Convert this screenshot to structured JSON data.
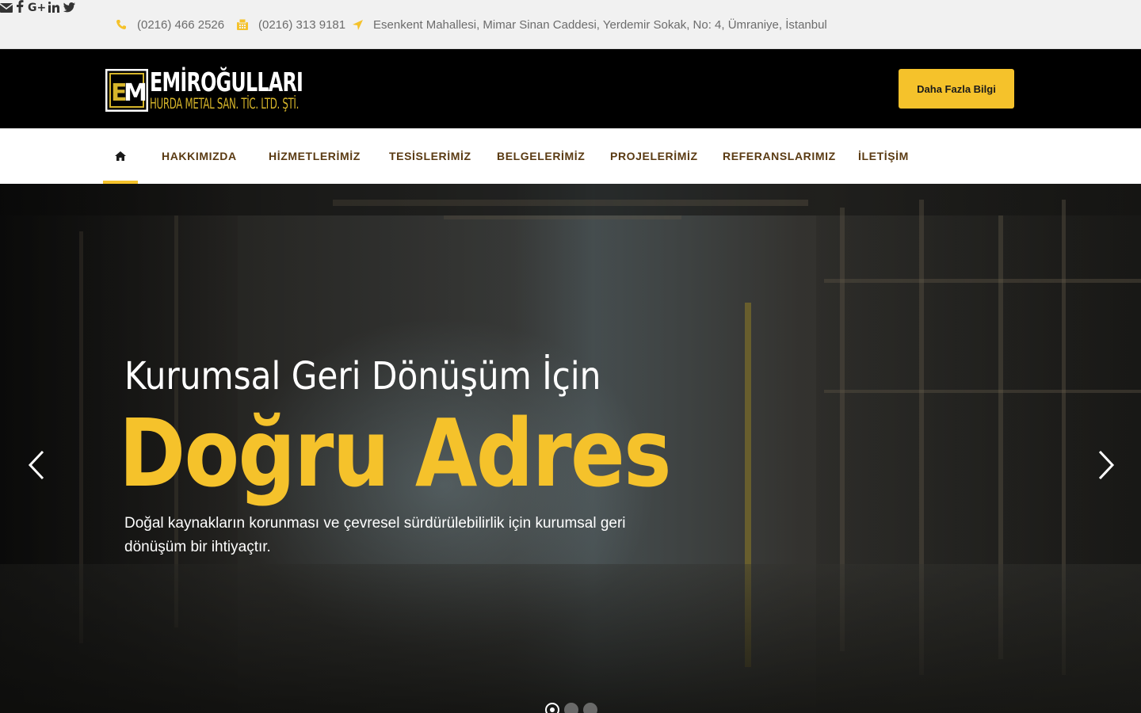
{
  "topbar": {
    "phone": "(0216) 466 2526",
    "fax": "(0216) 313 9181",
    "address": "Esenkent Mahallesi, Mimar Sinan Caddesi, Yerdemir Sokak, No: 4, Ümraniye, İstanbul",
    "icon_color": "#f5c22b",
    "social": [
      "envelope-icon",
      "facebook-icon",
      "google-plus-icon",
      "linkedin-icon",
      "twitter-icon"
    ]
  },
  "header": {
    "logo_line1": "EMİROĞULLARI",
    "logo_line2": "HURDA METAL SAN. TİC. LTD. ŞTİ.",
    "cta_label": "Daha Fazla Bilgi",
    "accent": "#f5c22b"
  },
  "nav": {
    "items": [
      "HAKKIMIZDA",
      "HİZMETLERİMİZ",
      "TESİSLERİMİZ",
      "BELGELERİMİZ",
      "PROJELERİMİZ",
      "REFERANSLARIMIZ",
      "İLETİŞİM"
    ],
    "text_color": "#5a3a12"
  },
  "hero": {
    "subtitle": "Kurumsal Geri Dönüşüm İçin",
    "title": "Doğru Adres",
    "description": "Doğal kaynakların korunması ve çevresel sürdürülebilirlik için kurumsal geri dönüşüm bir ihtiyaçtır.",
    "slide_count": 3,
    "active_slide": 1
  }
}
